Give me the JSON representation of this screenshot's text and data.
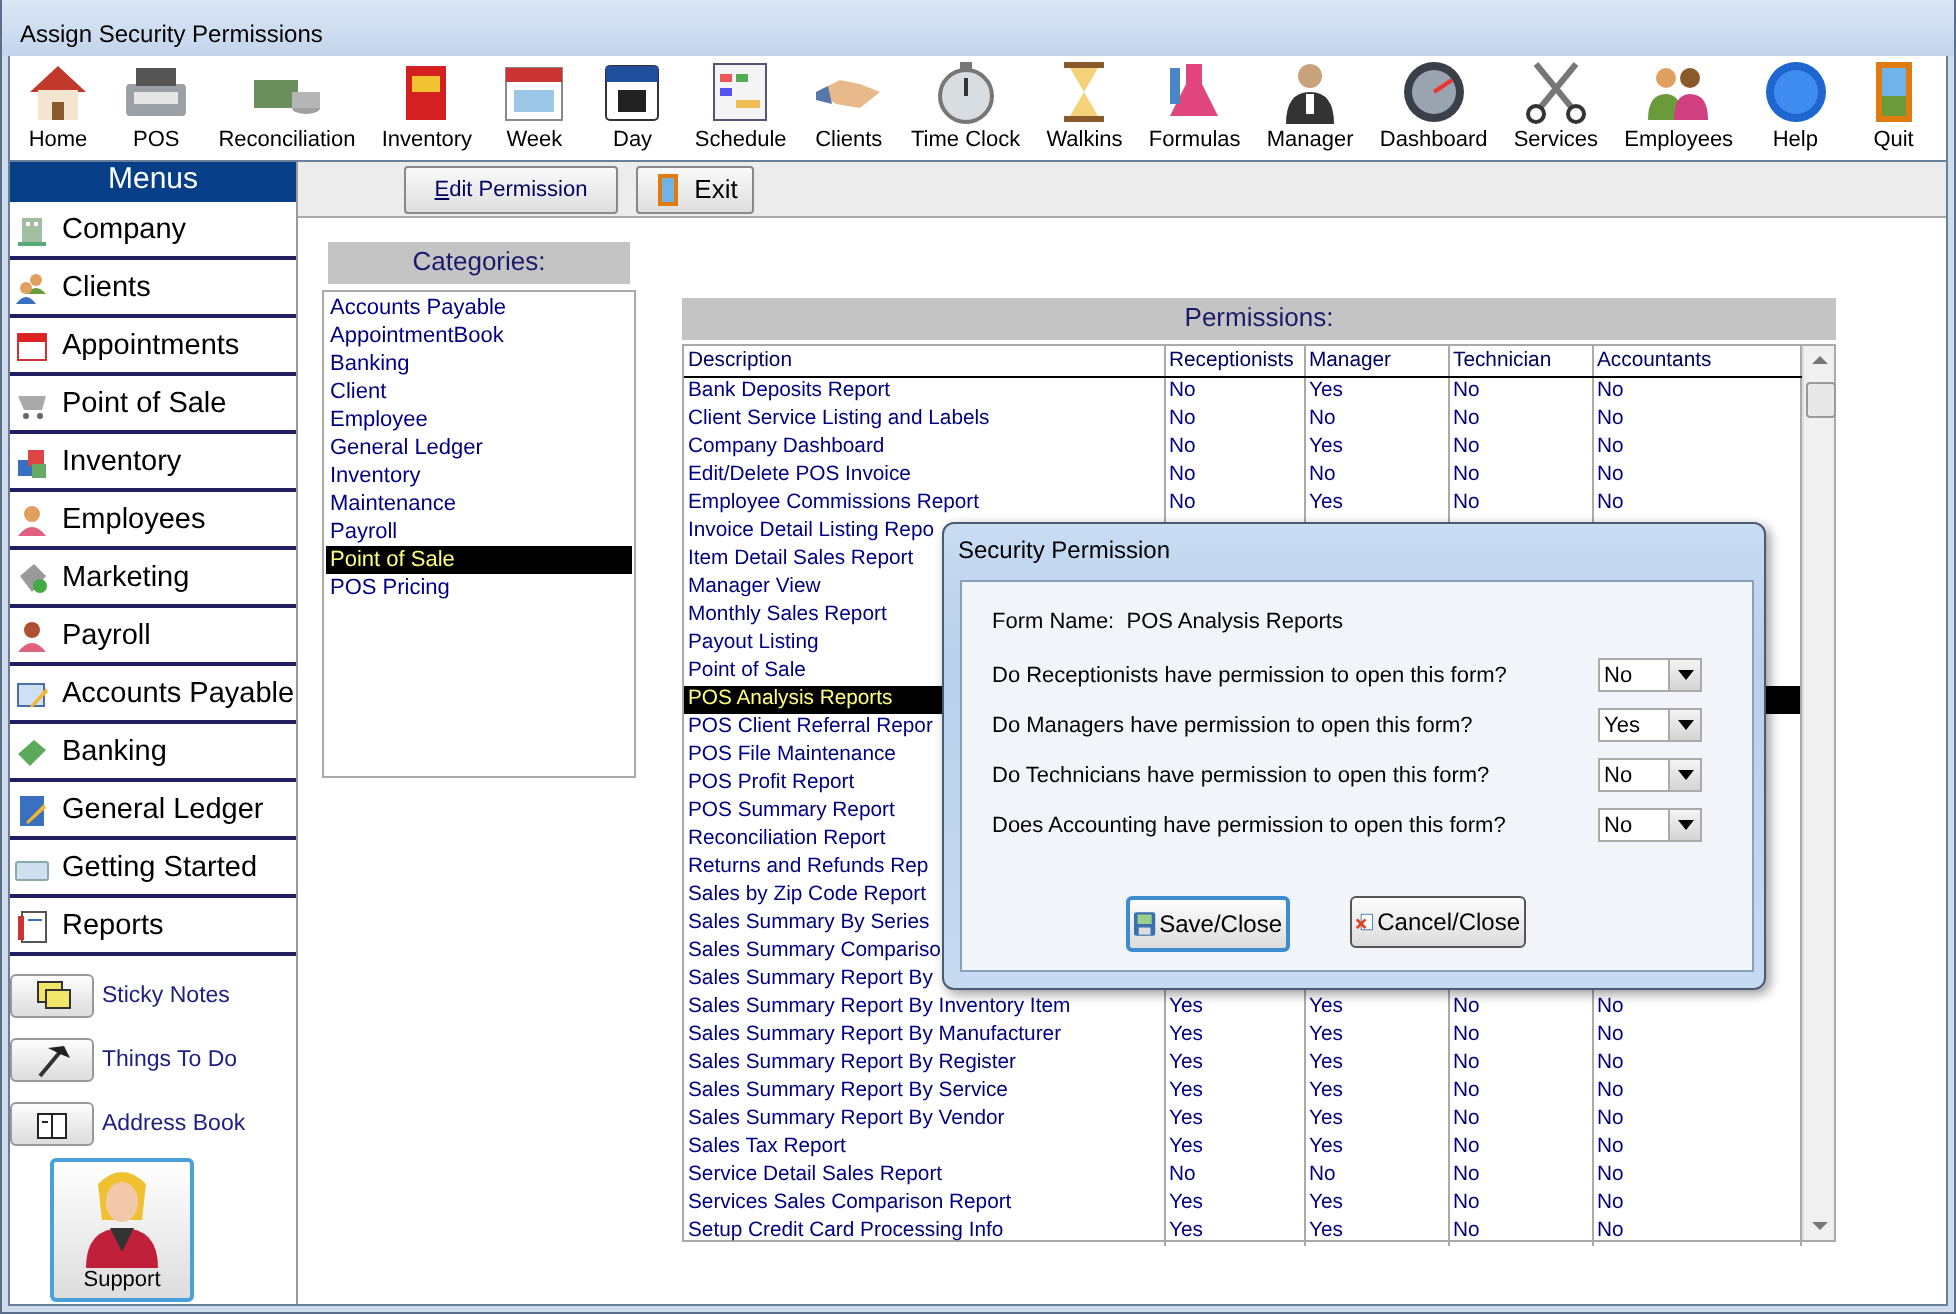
{
  "window": {
    "title": "Assign Security Permissions"
  },
  "toolbar": [
    {
      "label": "Home"
    },
    {
      "label": "POS"
    },
    {
      "label": "Reconciliation"
    },
    {
      "label": "Inventory"
    },
    {
      "label": "Week"
    },
    {
      "label": "Day"
    },
    {
      "label": "Schedule"
    },
    {
      "label": "Clients"
    },
    {
      "label": "Time Clock"
    },
    {
      "label": "Walkins"
    },
    {
      "label": "Formulas"
    },
    {
      "label": "Manager"
    },
    {
      "label": "Dashboard"
    },
    {
      "label": "Services"
    },
    {
      "label": "Employees"
    },
    {
      "label": "Help"
    },
    {
      "label": "Quit"
    }
  ],
  "sidebar": {
    "title": "Menus",
    "items": [
      {
        "label": "Company"
      },
      {
        "label": "Clients"
      },
      {
        "label": "Appointments"
      },
      {
        "label": "Point of Sale"
      },
      {
        "label": "Inventory"
      },
      {
        "label": "Employees"
      },
      {
        "label": "Marketing"
      },
      {
        "label": "Payroll"
      },
      {
        "label": "Accounts Payable"
      },
      {
        "label": "Banking"
      },
      {
        "label": "General Ledger"
      },
      {
        "label": "Getting Started"
      },
      {
        "label": "Reports"
      }
    ],
    "shortcuts": [
      {
        "label": "Sticky Notes"
      },
      {
        "label": "Things To Do"
      },
      {
        "label": "Address Book"
      }
    ],
    "support": {
      "label": "Support"
    }
  },
  "actions": [
    {
      "label": "Edit Permission",
      "kind": "text"
    },
    {
      "label": "Exit",
      "kind": "door"
    }
  ],
  "categories": {
    "title": "Categories:",
    "items": [
      {
        "label": "Accounts Payable",
        "selected": false
      },
      {
        "label": "AppointmentBook",
        "selected": false
      },
      {
        "label": "Banking",
        "selected": false
      },
      {
        "label": "Client",
        "selected": false
      },
      {
        "label": "Employee",
        "selected": false
      },
      {
        "label": "General Ledger",
        "selected": false
      },
      {
        "label": "Inventory",
        "selected": false
      },
      {
        "label": "Maintenance",
        "selected": false
      },
      {
        "label": "Payroll",
        "selected": false
      },
      {
        "label": "Point of Sale",
        "selected": true
      },
      {
        "label": "POS Pricing",
        "selected": false
      }
    ]
  },
  "permissions": {
    "title": "Permissions:",
    "columns": [
      "Description",
      "Receptionists",
      "Manager",
      "Technician",
      "Accountants"
    ],
    "rows": [
      {
        "description": "Bank Deposits Report",
        "values": [
          "No",
          "Yes",
          "No",
          "No"
        ],
        "selected": false
      },
      {
        "description": "Client Service Listing and Labels",
        "values": [
          "No",
          "No",
          "No",
          "No"
        ],
        "selected": false
      },
      {
        "description": "Company Dashboard",
        "values": [
          "No",
          "Yes",
          "No",
          "No"
        ],
        "selected": false
      },
      {
        "description": "Edit/Delete POS Invoice",
        "values": [
          "No",
          "No",
          "No",
          "No"
        ],
        "selected": false
      },
      {
        "description": "Employee Commissions Report",
        "values": [
          "No",
          "Yes",
          "No",
          "No"
        ],
        "selected": false
      },
      {
        "description": "Invoice Detail Listing Repo",
        "selected": false
      },
      {
        "description": "Item Detail Sales Report",
        "selected": false
      },
      {
        "description": "Manager View",
        "selected": false
      },
      {
        "description": "Monthly Sales Report",
        "selected": false
      },
      {
        "description": "Payout Listing",
        "selected": false
      },
      {
        "description": "Point of Sale",
        "selected": false
      },
      {
        "description": "POS Analysis Reports",
        "selected": true
      },
      {
        "description": "POS Client Referral Repor",
        "selected": false
      },
      {
        "description": "POS File Maintenance",
        "selected": false
      },
      {
        "description": "POS Profit Report",
        "selected": false
      },
      {
        "description": "POS Summary Report",
        "selected": false
      },
      {
        "description": "Reconciliation Report",
        "selected": false
      },
      {
        "description": "Returns and Refunds Rep",
        "selected": false
      },
      {
        "description": "Sales by Zip Code Report",
        "selected": false
      },
      {
        "description": "Sales Summary By Series",
        "selected": false
      },
      {
        "description": "Sales Summary Compariso",
        "selected": false
      },
      {
        "description": "Sales Summary Report By",
        "selected": false
      },
      {
        "description": "Sales Summary Report By Inventory Item",
        "values": [
          "Yes",
          "Yes",
          "No",
          "No"
        ],
        "selected": false
      },
      {
        "description": "Sales Summary Report By Manufacturer",
        "values": [
          "Yes",
          "Yes",
          "No",
          "No"
        ],
        "selected": false
      },
      {
        "description": "Sales Summary Report By Register",
        "values": [
          "Yes",
          "Yes",
          "No",
          "No"
        ],
        "selected": false
      },
      {
        "description": "Sales Summary Report By Service",
        "values": [
          "Yes",
          "Yes",
          "No",
          "No"
        ],
        "selected": false
      },
      {
        "description": "Sales Summary Report By Vendor",
        "values": [
          "Yes",
          "Yes",
          "No",
          "No"
        ],
        "selected": false
      },
      {
        "description": "Sales Tax Report",
        "values": [
          "Yes",
          "Yes",
          "No",
          "No"
        ],
        "selected": false
      },
      {
        "description": "Service Detail Sales Report",
        "values": [
          "No",
          "No",
          "No",
          "No"
        ],
        "selected": false
      },
      {
        "description": "Services Sales Comparison Report",
        "values": [
          "Yes",
          "Yes",
          "No",
          "No"
        ],
        "selected": false
      },
      {
        "description": "Setup Credit Card Processing Info",
        "values": [
          "Yes",
          "Yes",
          "No",
          "No"
        ],
        "selected": false
      }
    ]
  },
  "dialog": {
    "title": "Security Permission",
    "form_name": "Form Name:  POS Analysis Reports",
    "questions": [
      {
        "text": "Do Receptionists have permission to open this form?",
        "value": "No"
      },
      {
        "text": "Do Managers have permission to open this form?",
        "value": "Yes"
      },
      {
        "text": "Do Technicians have permission to open this form?",
        "value": "No"
      },
      {
        "text": "Does Accounting have permission to open this form?",
        "value": "No"
      }
    ],
    "buttons": [
      {
        "label": "Save/Close",
        "kind": "save"
      },
      {
        "label": "Cancel/Close",
        "kind": "cancel"
      }
    ]
  }
}
